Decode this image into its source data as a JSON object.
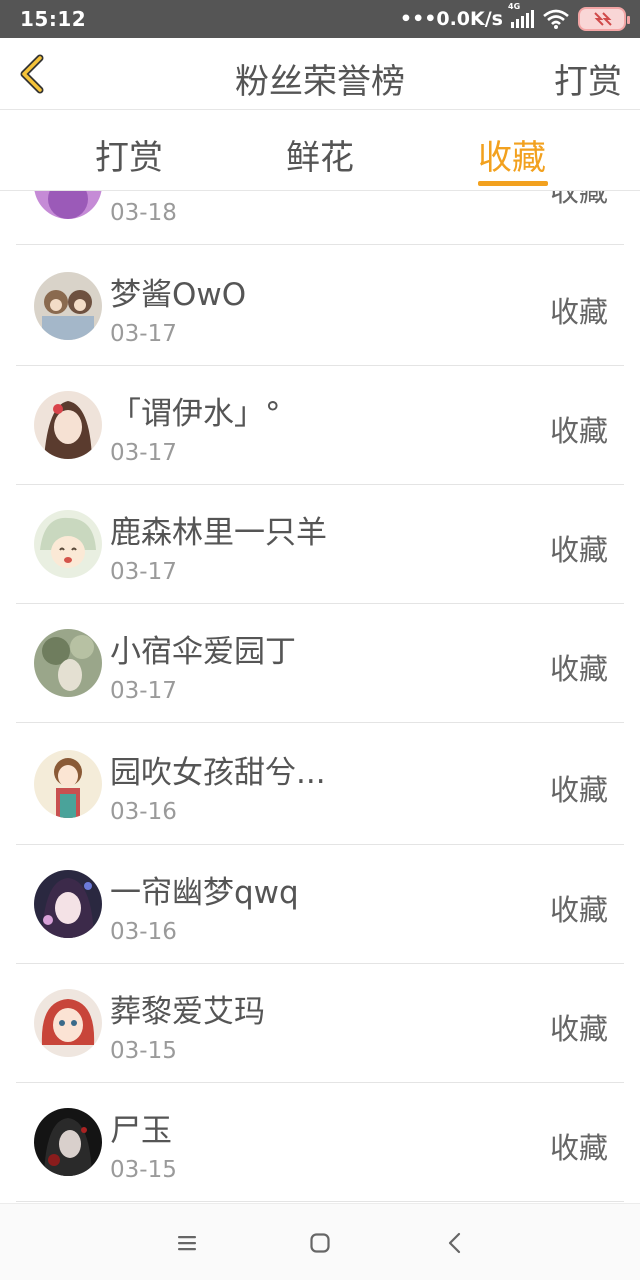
{
  "status_bar": {
    "time": "15:12",
    "net_speed": "0.0K/s",
    "net_type": "4G"
  },
  "header": {
    "title": "粉丝荣誉榜",
    "right_button": "打赏"
  },
  "tabs": [
    {
      "label": "打赏",
      "active": false
    },
    {
      "label": "鲜花",
      "active": false
    },
    {
      "label": "收藏",
      "active": true
    }
  ],
  "list": [
    {
      "name": "",
      "date": "03-18",
      "action": "收藏"
    },
    {
      "name": "梦酱OwO",
      "date": "03-17",
      "action": "收藏"
    },
    {
      "name": "「谓伊水」°",
      "date": "03-17",
      "action": "收藏"
    },
    {
      "name": "鹿森林里一只羊",
      "date": "03-17",
      "action": "收藏"
    },
    {
      "name": "小宿伞爱园丁",
      "date": "03-17",
      "action": "收藏"
    },
    {
      "name": "园吹女孩甜兮...",
      "date": "03-16",
      "action": "收藏"
    },
    {
      "name": "一帘幽梦qwq",
      "date": "03-16",
      "action": "收藏"
    },
    {
      "name": "葬黎爱艾玛",
      "date": "03-15",
      "action": "收藏"
    },
    {
      "name": "尸玉",
      "date": "03-15",
      "action": "收藏"
    }
  ],
  "colors": {
    "accent": "#f2a11f",
    "status_bar": "#555555",
    "text": "#555555",
    "subtext": "#9a9a9a"
  },
  "icons": {
    "back": "chevron-left-icon",
    "nav_menu": "menu-icon",
    "nav_home": "home-square-icon",
    "nav_back": "back-triangle-icon"
  }
}
